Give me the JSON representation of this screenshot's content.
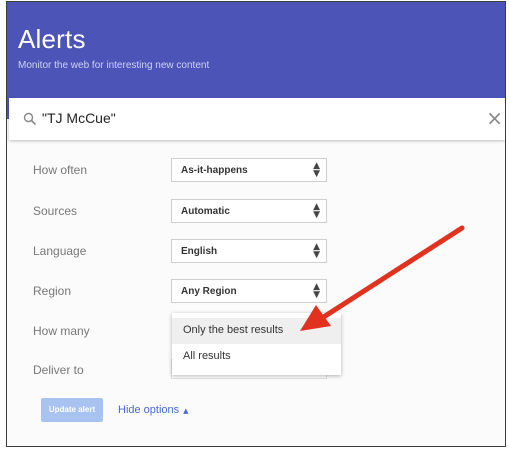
{
  "header": {
    "title": "Alerts",
    "subtitle": "Monitor the web for interesting new content"
  },
  "search": {
    "value": "\"TJ McCue\"",
    "icon": "search-icon",
    "close_glyph": "×"
  },
  "options": [
    {
      "label": "How often",
      "value": "As-it-happens"
    },
    {
      "label": "Sources",
      "value": "Automatic"
    },
    {
      "label": "Language",
      "value": "English"
    },
    {
      "label": "Region",
      "value": "Any Region"
    },
    {
      "label": "How many",
      "value": ""
    },
    {
      "label": "Deliver to",
      "value": ""
    }
  ],
  "how_many_dropdown": {
    "options": [
      "Only the best results",
      "All results"
    ],
    "highlighted": "Only the best results"
  },
  "footer": {
    "update_button": "Update alert",
    "hide_options": "Hide options"
  },
  "colors": {
    "header_bg": "#4c55b7",
    "update_button_bg": "#a9c3f1",
    "link": "#4a6ad2",
    "arrow": "#e0321e"
  }
}
